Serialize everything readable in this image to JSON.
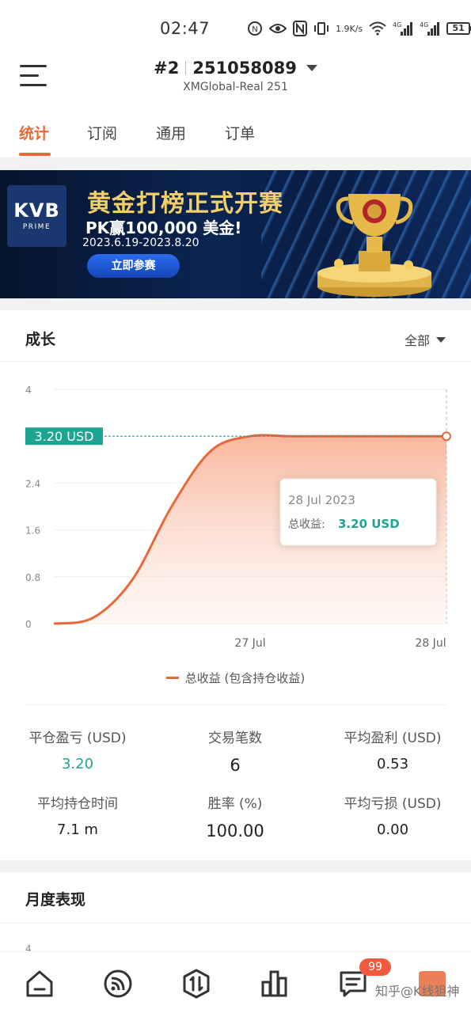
{
  "status_bar": {
    "time": "02:47",
    "net_speed_value": "1.9",
    "net_speed_unit": "K/s",
    "signal1_label": "4G",
    "signal2_label": "4G",
    "battery": "51",
    "icons": [
      "nfc-alarm-icon",
      "eye-icon",
      "nfc-icon",
      "vibrate-icon",
      "wifi-icon",
      "signal-icon",
      "signal-icon",
      "battery-icon"
    ]
  },
  "header": {
    "account_index": "#2",
    "account_number": "251058089",
    "account_server": "XMGlobal-Real 251"
  },
  "tabs": [
    "统计",
    "订阅",
    "通用",
    "订单"
  ],
  "active_tab": "统计",
  "banner": {
    "logo_main": "KVB",
    "logo_sub": "PRIME",
    "title": "黄金打榜正式开赛",
    "subtitle": "PK赢100,000 美金!",
    "dates": "2023.6.19-2023.8.20",
    "button_label": "立即参赛"
  },
  "growth_card": {
    "title": "成长",
    "filter_label": "全部",
    "legend": "总收益 (包含持仓收益)",
    "tooltip_date": "28 Jul 2023",
    "tooltip_label": "总收益:",
    "tooltip_value": "3.20 USD",
    "current_value_label": "3.20 USD"
  },
  "chart_data": {
    "type": "area",
    "x_labels": [
      "27 Jul",
      "28 Jul"
    ],
    "y_ticks": [
      "4",
      "2.4",
      "1.6",
      "0.8",
      "0"
    ],
    "ylim": [
      0,
      4
    ],
    "series": [
      {
        "name": "总收益 (包含持仓收益)",
        "x": [
          0,
          0.1,
          0.2,
          0.3,
          0.4,
          0.5,
          0.6,
          0.7,
          0.8,
          0.9,
          1.0
        ],
        "y": [
          0,
          0.1,
          0.75,
          2.0,
          2.95,
          3.2,
          3.2,
          3.2,
          3.2,
          3.2,
          3.2
        ]
      }
    ],
    "reference_line": 3.2,
    "grid": true,
    "line_color": "#e8683a",
    "fill_color": "#fbd4c4",
    "ref_color": "#1fa392"
  },
  "stats": [
    {
      "label": "平仓盈亏 (USD)",
      "value": "3.20",
      "highlight": true
    },
    {
      "label": "交易笔数",
      "value": "6"
    },
    {
      "label": "平均盈利 (USD)",
      "value": "0.53"
    },
    {
      "label": "平均持仓时间",
      "value": "7.1 m"
    },
    {
      "label": "胜率 (%)",
      "value": "100.00"
    },
    {
      "label": "平均亏损 (USD)",
      "value": "0.00"
    }
  ],
  "monthly_card": {
    "title": "月度表现",
    "first_tick": "4"
  },
  "bottom_nav": {
    "items": [
      "home-icon",
      "broadcast-icon",
      "trade-icon",
      "chart-icon",
      "message-icon",
      "user-icon"
    ],
    "message_badge": "99",
    "watermark": "知乎@K线狙神"
  }
}
